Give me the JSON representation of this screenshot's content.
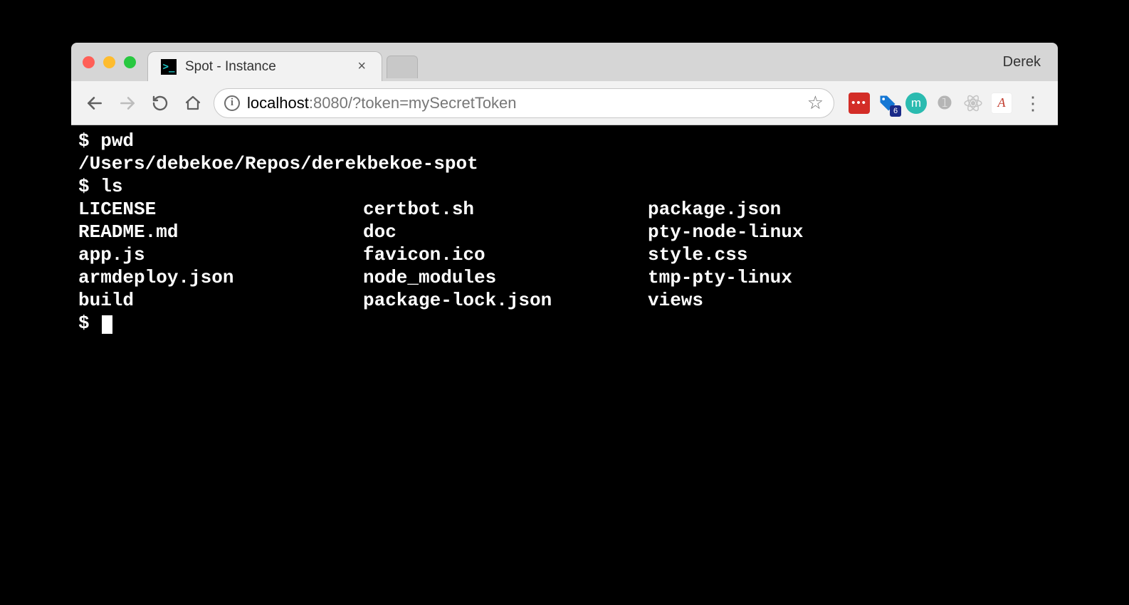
{
  "tabstrip": {
    "tab_title": "Spot - Instance",
    "profile_name": "Derek"
  },
  "toolbar": {
    "url_host": "localhost",
    "url_rest": ":8080/?token=mySecretToken",
    "ext_badge": "6"
  },
  "terminal": {
    "cmd_pwd": "pwd",
    "pwd_output": "/Users/debekoe/Repos/derekbekoe-spot",
    "cmd_ls": "ls",
    "ls_cols": [
      [
        "LICENSE",
        "README.md",
        "app.js",
        "armdeploy.json",
        "build"
      ],
      [
        "certbot.sh",
        "doc",
        "favicon.ico",
        "node_modules",
        "package-lock.json"
      ],
      [
        "package.json",
        "pty-node-linux",
        "style.css",
        "tmp-pty-linux",
        "views"
      ]
    ],
    "final_prompt": "$"
  }
}
